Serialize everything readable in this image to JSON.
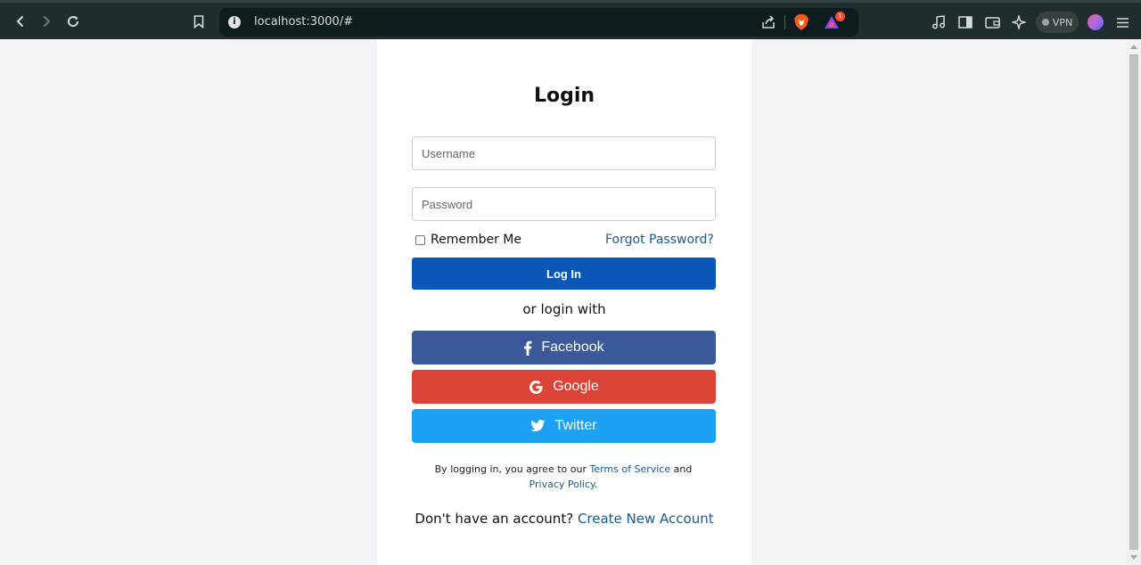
{
  "browser": {
    "url": "localhost:3000/#",
    "vpn_label": "VPN",
    "notification_count": "1",
    "icons": [
      "back-icon",
      "forward-icon",
      "reload-icon",
      "bookmark-icon",
      "info-icon",
      "share-icon",
      "brave-shield-icon",
      "brave-rewards-icon",
      "media-icon",
      "sidebar-icon",
      "wallet-icon",
      "leo-ai-icon",
      "vpn-icon",
      "profile-icon",
      "menu-icon"
    ]
  },
  "login": {
    "title": "Login",
    "username_placeholder": "Username",
    "password_placeholder": "Password",
    "remember_label": "Remember Me",
    "forgot_label": "Forgot Password?",
    "login_button": "Log In",
    "or_text": "or login with",
    "facebook_label": "Facebook",
    "google_label": "Google",
    "twitter_label": "Twitter",
    "terms_prefix": "By logging in, you agree to our ",
    "terms_link": "Terms of Service",
    "terms_and": " and ",
    "privacy_link": "Privacy Policy",
    "terms_suffix": ".",
    "signup_prefix": "Don't have an account? ",
    "signup_link": "Create New Account"
  },
  "colors": {
    "primary": "#0b57b7",
    "facebook": "#3b5998",
    "google": "#db4437",
    "twitter": "#1da1f2",
    "link": "#1a5a94",
    "page_bg": "#f3f3f8"
  }
}
